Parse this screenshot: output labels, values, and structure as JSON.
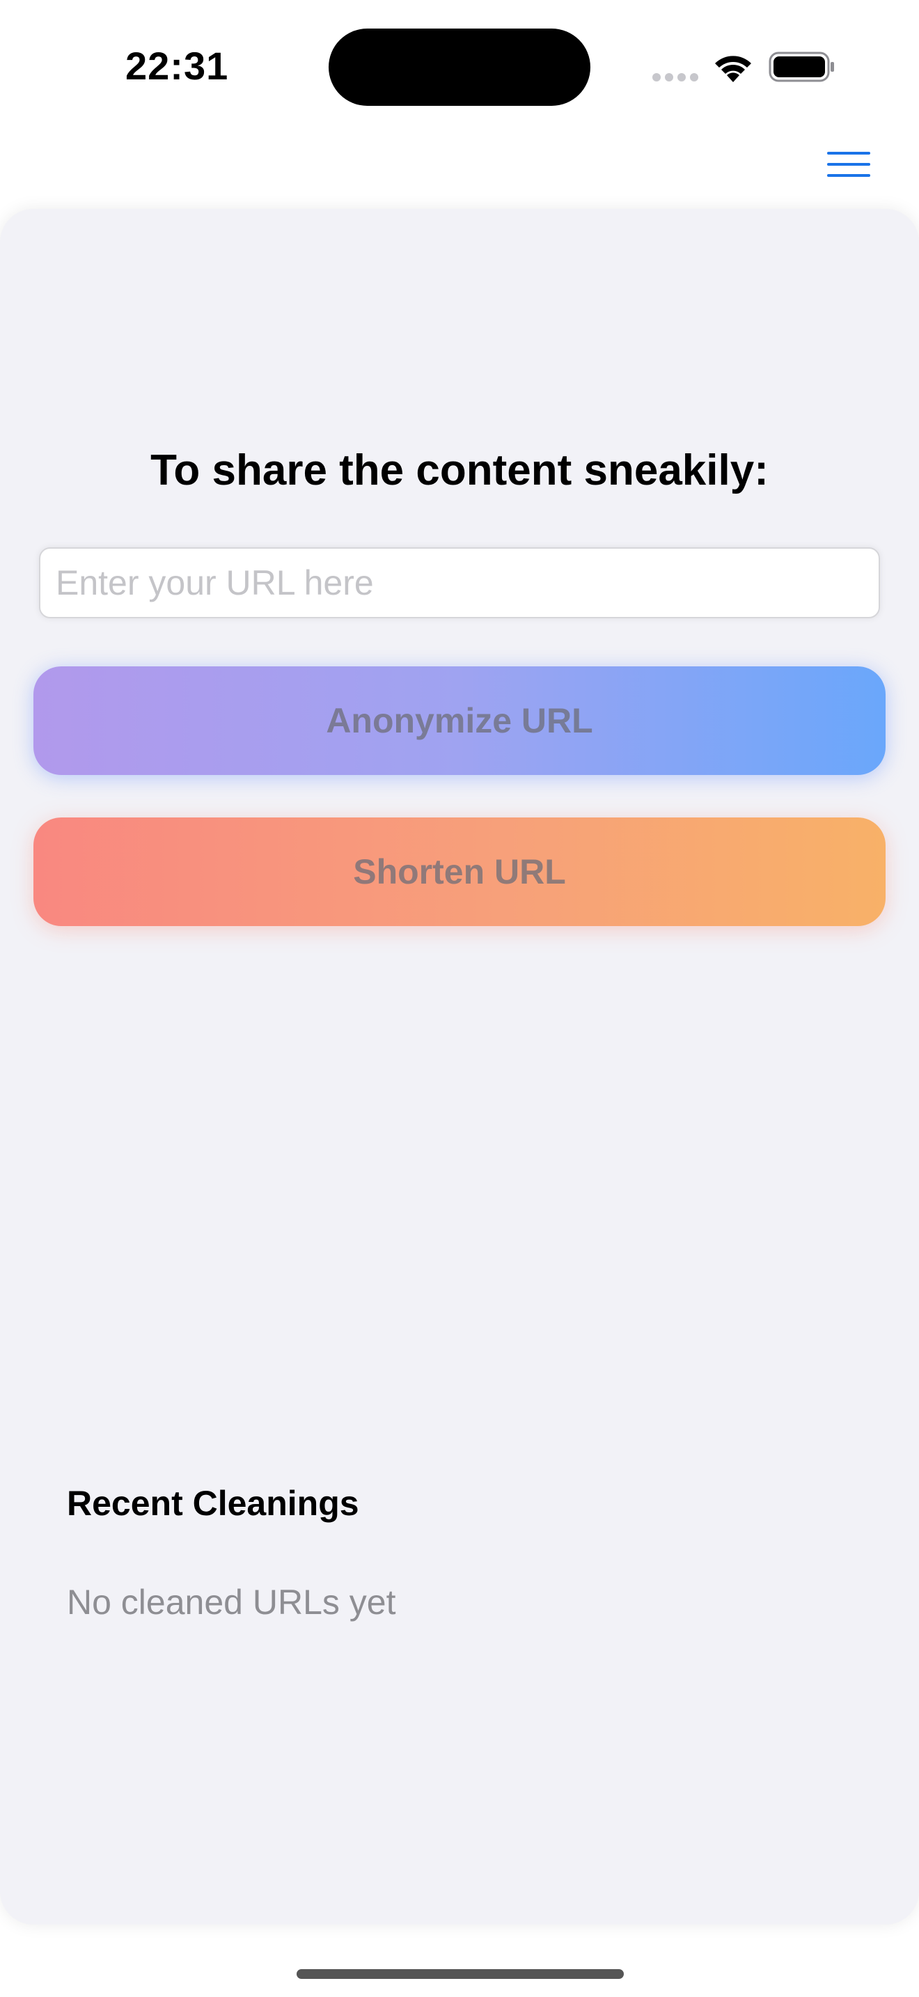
{
  "status_bar": {
    "time": "22:31"
  },
  "nav": {
    "menu_icon": "hamburger-menu-icon"
  },
  "main": {
    "heading": "To share the content sneakily:",
    "url_input": {
      "value": "",
      "placeholder": "Enter your URL here"
    },
    "anonymize_label": "Anonymize URL",
    "shorten_label": "Shorten URL"
  },
  "recent": {
    "title": "Recent Cleanings",
    "empty_message": "No cleaned URLs yet"
  },
  "colors": {
    "accent": "#1a73e8",
    "anonymize_gradient": [
      "#b199ec",
      "#6aa7fb"
    ],
    "shorten_gradient": [
      "#f98880",
      "#f8b168"
    ],
    "sheet_background": "#f2f2f7"
  }
}
